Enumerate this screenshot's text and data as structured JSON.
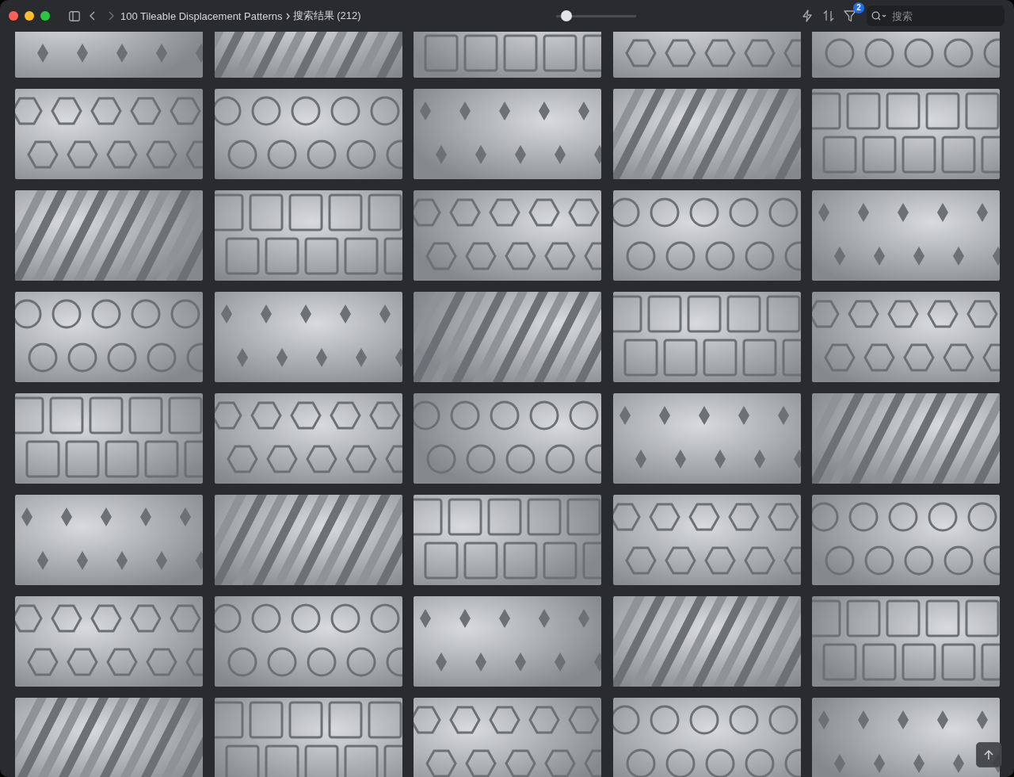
{
  "window": {
    "title": "100 Tileable Displacement Patterns",
    "breadcrumb": "搜索结果 (212)"
  },
  "zoom_slider": {
    "level": 0.13
  },
  "filter": {
    "badge": "2"
  },
  "search": {
    "placeholder": "搜索"
  }
}
